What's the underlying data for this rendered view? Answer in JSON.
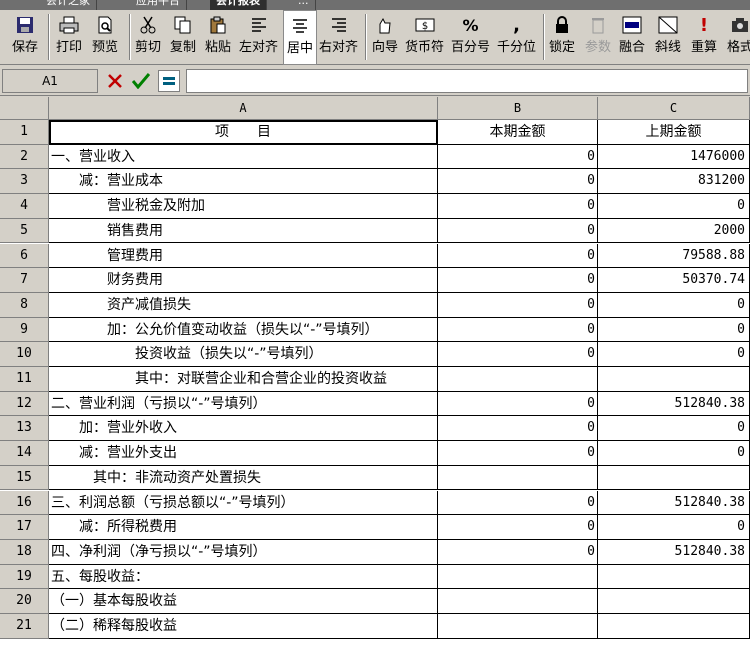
{
  "tabs": [
    "会计之家",
    "应用平台",
    "会计报表",
    "..."
  ],
  "toolbar": [
    {
      "label": "保存",
      "icon": "save-icon"
    },
    {
      "label": "打印",
      "icon": "print-icon"
    },
    {
      "label": "预览",
      "icon": "preview-icon"
    },
    {
      "label": "剪切",
      "icon": "cut-icon"
    },
    {
      "label": "复制",
      "icon": "copy-icon"
    },
    {
      "label": "粘贴",
      "icon": "paste-icon"
    },
    {
      "label": "左对齐",
      "icon": "align-left-icon"
    },
    {
      "label": "居中",
      "icon": "align-center-icon"
    },
    {
      "label": "右对齐",
      "icon": "align-right-icon"
    },
    {
      "label": "向导",
      "icon": "wizard-icon"
    },
    {
      "label": "货币符",
      "icon": "currency-icon"
    },
    {
      "label": "百分号",
      "icon": "percent-icon"
    },
    {
      "label": "千分位",
      "icon": "thousands-separator-icon"
    },
    {
      "label": "锁定",
      "icon": "lock-icon"
    },
    {
      "label": "参数",
      "icon": "parameter-icon"
    },
    {
      "label": "融合",
      "icon": "merge-icon"
    },
    {
      "label": "斜线",
      "icon": "diagonal-line-icon"
    },
    {
      "label": "重算",
      "icon": "recalculate-icon"
    },
    {
      "label": "格式",
      "icon": "format-icon"
    }
  ],
  "formula_bar": {
    "cell_ref": "A1",
    "value": ""
  },
  "columns": [
    "A",
    "B",
    "C"
  ],
  "rows": [
    {
      "n": "1",
      "a": "项　　目",
      "b": "本期金额",
      "c": "上期金额"
    },
    {
      "n": "2",
      "a": "一、营业收入",
      "b": "0",
      "c": "1476000"
    },
    {
      "n": "3",
      "a": "　　减：营业成本",
      "b": "0",
      "c": "831200"
    },
    {
      "n": "4",
      "a": "　　　　营业税金及附加",
      "b": "0",
      "c": "0"
    },
    {
      "n": "5",
      "a": "　　　　销售费用",
      "b": "0",
      "c": "2000"
    },
    {
      "n": "6",
      "a": "　　　　管理费用",
      "b": "0",
      "c": "79588.88"
    },
    {
      "n": "7",
      "a": "　　　　财务费用",
      "b": "0",
      "c": "50370.74"
    },
    {
      "n": "8",
      "a": "　　　　资产减值损失",
      "b": "0",
      "c": "0"
    },
    {
      "n": "9",
      "a": "　　　　加：公允价值变动收益（损失以“-”号填列）",
      "b": "0",
      "c": "0"
    },
    {
      "n": "10",
      "a": "　　　　　　投资收益（损失以“-”号填列）",
      "b": "0",
      "c": "0"
    },
    {
      "n": "11",
      "a": "　　　　　　其中：对联营企业和合营企业的投资收益",
      "b": "",
      "c": ""
    },
    {
      "n": "12",
      "a": "二、营业利润（亏损以“-”号填列）",
      "b": "0",
      "c": "512840.38"
    },
    {
      "n": "13",
      "a": "　　加：营业外收入",
      "b": "0",
      "c": "0"
    },
    {
      "n": "14",
      "a": "　　减：营业外支出",
      "b": "0",
      "c": "0"
    },
    {
      "n": "15",
      "a": "　　　其中：非流动资产处置损失",
      "b": "",
      "c": ""
    },
    {
      "n": "16",
      "a": "三、利润总额（亏损总额以“-”号填列）",
      "b": "0",
      "c": "512840.38"
    },
    {
      "n": "17",
      "a": "　　减：所得税费用",
      "b": "0",
      "c": "0"
    },
    {
      "n": "18",
      "a": "四、净利润（净亏损以“-”号填列）",
      "b": "0",
      "c": "512840.38"
    },
    {
      "n": "19",
      "a": "五、每股收益：",
      "b": "",
      "c": ""
    },
    {
      "n": "20",
      "a": "（一）基本每股收益",
      "b": "",
      "c": ""
    },
    {
      "n": "21",
      "a": "（二）稀释每股收益",
      "b": "",
      "c": ""
    }
  ]
}
